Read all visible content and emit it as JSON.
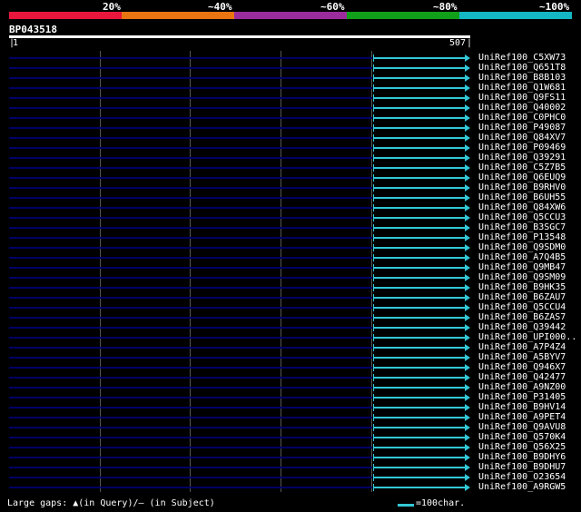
{
  "legend": {
    "percent_labels": [
      "20%",
      "~40%",
      "~60%",
      "~80%",
      "~100%"
    ],
    "colors": [
      "#e8163c",
      "#e87511",
      "#9b2c9e",
      "#11a01a",
      "#13b6c2"
    ]
  },
  "query": {
    "name": "BP043518",
    "start": "1",
    "end": "507"
  },
  "hits": [
    "UniRef100_C5XW73",
    "UniRef100_Q651T8",
    "UniRef100_B8B103",
    "UniRef100_Q1W681",
    "UniRef100_Q9FS11",
    "UniRef100_Q40002",
    "UniRef100_C0PHC0",
    "UniRef100_P49087",
    "UniRef100_Q84XV7",
    "UniRef100_P09469",
    "UniRef100_Q39291",
    "UniRef100_C5Z7B5",
    "UniRef100_Q6EUQ9",
    "UniRef100_B9RHV0",
    "UniRef100_B6UH55",
    "UniRef100_Q84XW6",
    "UniRef100_Q5CCU3",
    "UniRef100_B3SGC7",
    "UniRef100_P13548",
    "UniRef100_Q9SDM0",
    "UniRef100_A7Q4B5",
    "UniRef100_Q9MB47",
    "UniRef100_Q9SM09",
    "UniRef100_B9HK35",
    "UniRef100_B6ZAU7",
    "UniRef100_Q5CCU4",
    "UniRef100_B6ZAS7",
    "UniRef100_Q39442",
    "UniRef100_UPI000..",
    "UniRef100_A7P4Z4",
    "UniRef100_A5BYV7",
    "UniRef100_Q946X7",
    "UniRef100_Q42477",
    "UniRef100_A9NZ00",
    "UniRef100_P31405",
    "UniRef100_B9HV14",
    "UniRef100_A9PET4",
    "UniRef100_Q9AVU8",
    "UniRef100_Q570K4",
    "UniRef100_Q56X25",
    "UniRef100_B9DHY6",
    "UniRef100_B9DHU7",
    "UniRef100_O23654",
    "UniRef100_A9RGW5"
  ],
  "hit_range": {
    "start": 400,
    "end": 507
  },
  "footer": {
    "gaps_text": "Large gaps: ▲(in Query)/— (in Subject)",
    "scale_text": "=100char."
  }
}
